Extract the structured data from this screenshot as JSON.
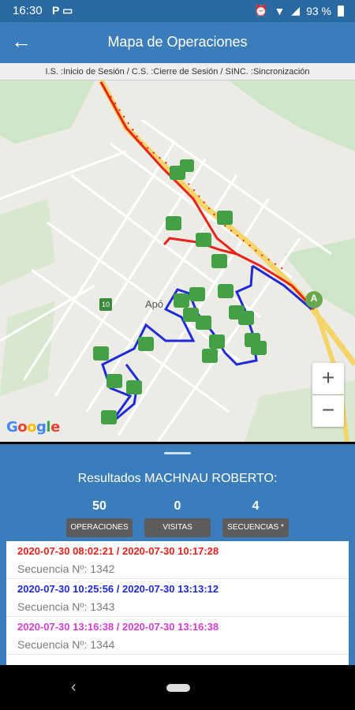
{
  "status": {
    "time": "16:30",
    "left_icons": "P ▭",
    "battery": "93 %",
    "alarm_icon": "alarm-icon",
    "wifi_icon": "wifi-icon",
    "signal_icon": "signal-icon"
  },
  "appbar": {
    "title": "Mapa de Operaciones",
    "back_icon": "←"
  },
  "legend": {
    "text": "I.S. :Inicio de Sesión / C.S. :Cierre de Sesión / SINC. :Sincronización"
  },
  "map": {
    "place_label": "Apó",
    "route_shield": "10",
    "marker_start": "A",
    "zoom_in": "+",
    "zoom_out": "−",
    "google_letters": [
      "G",
      "o",
      "o",
      "g",
      "l",
      "e"
    ],
    "route_colors": {
      "first": "#e8231a",
      "second": "#1f2bd6"
    },
    "marker_color": "#43a047"
  },
  "results": {
    "title": "Resultados MACHNAU ROBERTO:",
    "stats": [
      {
        "value": "50",
        "label": "OPERACIONES"
      },
      {
        "value": "0",
        "label": "VISITAS"
      },
      {
        "value": "4",
        "label": "SECUENCIAS *"
      }
    ],
    "items": [
      {
        "dates": "2020-07-30 08:02:21 /  2020-07-30 10:17:28",
        "seq": "Secuencia Nº: 1342",
        "color": "#e8231a"
      },
      {
        "dates": "2020-07-30 10:25:56 /  2020-07-30 13:13:12",
        "seq": "Secuencia Nº: 1343",
        "color": "#1f2bd6"
      },
      {
        "dates": "2020-07-30 13:16:38 /  2020-07-30 13:16:38",
        "seq": "Secuencia Nº: 1344",
        "color": "#d23fd0"
      }
    ]
  },
  "nav": {
    "back": "‹"
  }
}
